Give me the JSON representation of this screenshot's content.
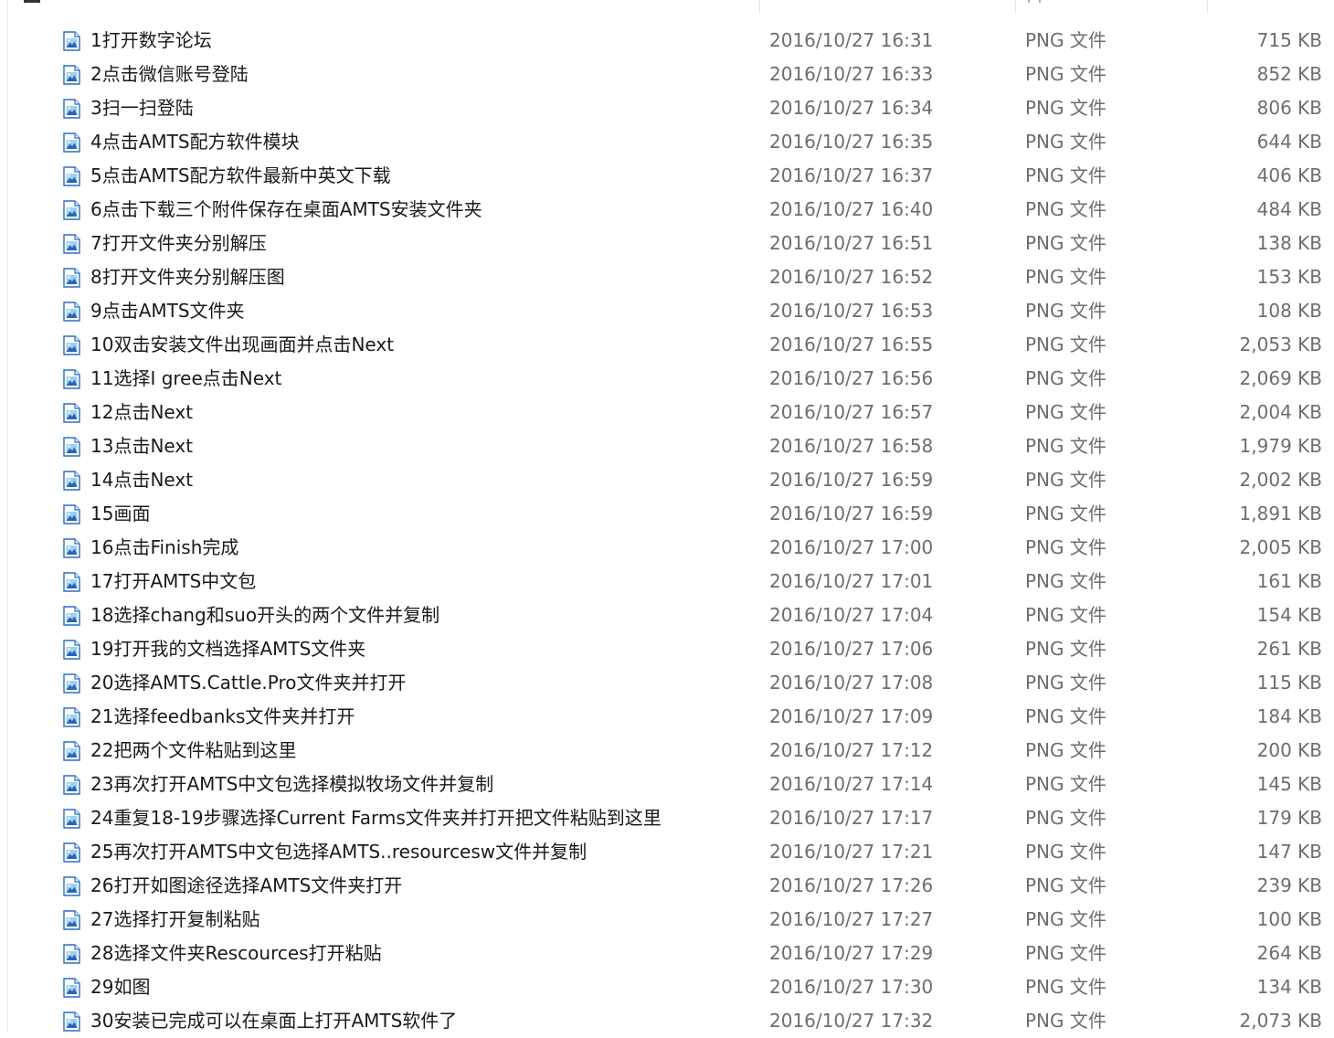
{
  "files": [
    {
      "name": "1打开数字论坛",
      "date": "2016/10/27 16:31",
      "type": "PNG 文件",
      "size": "715 KB"
    },
    {
      "name": "2点击微信账号登陆",
      "date": "2016/10/27 16:33",
      "type": "PNG 文件",
      "size": "852 KB"
    },
    {
      "name": "3扫一扫登陆",
      "date": "2016/10/27 16:34",
      "type": "PNG 文件",
      "size": "806 KB"
    },
    {
      "name": "4点击AMTS配方软件模块",
      "date": "2016/10/27 16:35",
      "type": "PNG 文件",
      "size": "644 KB"
    },
    {
      "name": "5点击AMTS配方软件最新中英文下载",
      "date": "2016/10/27 16:37",
      "type": "PNG 文件",
      "size": "406 KB"
    },
    {
      "name": "6点击下载三个附件保存在桌面AMTS安装文件夹",
      "date": "2016/10/27 16:40",
      "type": "PNG 文件",
      "size": "484 KB"
    },
    {
      "name": "7打开文件夹分别解压",
      "date": "2016/10/27 16:51",
      "type": "PNG 文件",
      "size": "138 KB"
    },
    {
      "name": "8打开文件夹分别解压图",
      "date": "2016/10/27 16:52",
      "type": "PNG 文件",
      "size": "153 KB"
    },
    {
      "name": "9点击AMTS文件夹",
      "date": "2016/10/27 16:53",
      "type": "PNG 文件",
      "size": "108 KB"
    },
    {
      "name": "10双击安装文件出现画面并点击Next",
      "date": "2016/10/27 16:55",
      "type": "PNG 文件",
      "size": "2,053 KB"
    },
    {
      "name": "11选择I gree点击Next",
      "date": "2016/10/27 16:56",
      "type": "PNG 文件",
      "size": "2,069 KB"
    },
    {
      "name": "12点击Next",
      "date": "2016/10/27 16:57",
      "type": "PNG 文件",
      "size": "2,004 KB"
    },
    {
      "name": "13点击Next",
      "date": "2016/10/27 16:58",
      "type": "PNG 文件",
      "size": "1,979 KB"
    },
    {
      "name": "14点击Next",
      "date": "2016/10/27 16:59",
      "type": "PNG 文件",
      "size": "2,002 KB"
    },
    {
      "name": "15画面",
      "date": "2016/10/27 16:59",
      "type": "PNG 文件",
      "size": "1,891 KB"
    },
    {
      "name": "16点击Finish完成",
      "date": "2016/10/27 17:00",
      "type": "PNG 文件",
      "size": "2,005 KB"
    },
    {
      "name": "17打开AMTS中文包",
      "date": "2016/10/27 17:01",
      "type": "PNG 文件",
      "size": "161 KB"
    },
    {
      "name": "18选择chang和suo开头的两个文件并复制",
      "date": "2016/10/27 17:04",
      "type": "PNG 文件",
      "size": "154 KB"
    },
    {
      "name": "19打开我的文档选择AMTS文件夹",
      "date": "2016/10/27 17:06",
      "type": "PNG 文件",
      "size": "261 KB"
    },
    {
      "name": "20选择AMTS.Cattle.Pro文件夹并打开",
      "date": "2016/10/27 17:08",
      "type": "PNG 文件",
      "size": "115 KB"
    },
    {
      "name": "21选择feedbanks文件夹并打开",
      "date": "2016/10/27 17:09",
      "type": "PNG 文件",
      "size": "184 KB"
    },
    {
      "name": "22把两个文件粘贴到这里",
      "date": "2016/10/27 17:12",
      "type": "PNG 文件",
      "size": "200 KB"
    },
    {
      "name": "23再次打开AMTS中文包选择模拟牧场文件并复制",
      "date": "2016/10/27 17:14",
      "type": "PNG 文件",
      "size": "145 KB"
    },
    {
      "name": "24重复18-19步骤选择Current Farms文件夹并打开把文件粘贴到这里",
      "date": "2016/10/27 17:17",
      "type": "PNG 文件",
      "size": "179 KB"
    },
    {
      "name": "25再次打开AMTS中文包选择AMTS..resourcesw文件并复制",
      "date": "2016/10/27 17:21",
      "type": "PNG 文件",
      "size": "147 KB"
    },
    {
      "name": "26打开如图途径选择AMTS文件夹打开",
      "date": "2016/10/27 17:26",
      "type": "PNG 文件",
      "size": "239 KB"
    },
    {
      "name": "27选择打开复制粘贴",
      "date": "2016/10/27 17:27",
      "type": "PNG 文件",
      "size": "100 KB"
    },
    {
      "name": "28选择文件夹Rescources打开粘贴",
      "date": "2016/10/27 17:29",
      "type": "PNG 文件",
      "size": "264 KB"
    },
    {
      "name": "29如图",
      "date": "2016/10/27 17:30",
      "type": "PNG 文件",
      "size": "134 KB"
    },
    {
      "name": "30安装已完成可以在桌面上打开AMTS软件了",
      "date": "2016/10/27 17:32",
      "type": "PNG 文件",
      "size": "2,073 KB"
    }
  ],
  "icon": {
    "name": "png-image-file-icon",
    "frame_color": "#2b6fc4",
    "sky_color": "#9fd0f2",
    "hill_color": "#2a64b3"
  }
}
